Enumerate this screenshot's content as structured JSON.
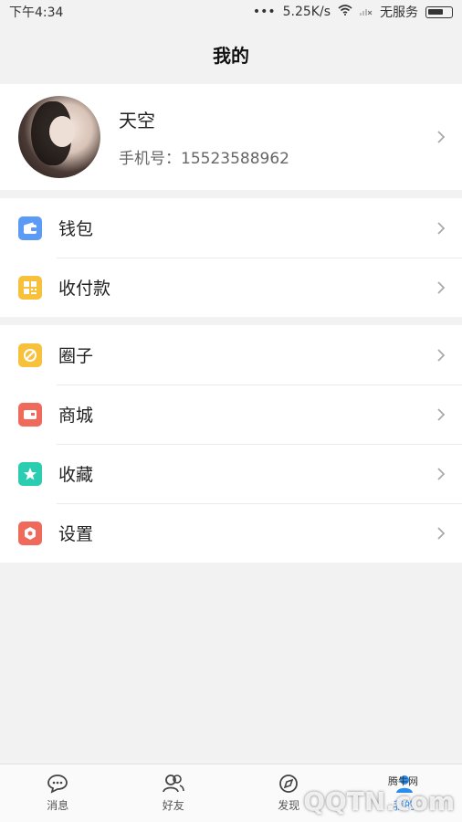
{
  "status_bar": {
    "time": "下午4:34",
    "dots": "•••",
    "speed": "5.25K/s",
    "carrier": "无服务"
  },
  "header": {
    "title": "我的"
  },
  "profile": {
    "name": "天空",
    "phone": "手机号：15523588962"
  },
  "menu_group_1": [
    {
      "label": "钱包",
      "icon": "wallet-icon",
      "color": "#5b9bf5"
    },
    {
      "label": "收付款",
      "icon": "qrcode-icon",
      "color": "#f7c13c"
    }
  ],
  "menu_group_2": [
    {
      "label": "圈子",
      "icon": "circle-icon",
      "color": "#f7c13c"
    },
    {
      "label": "商城",
      "icon": "shop-icon",
      "color": "#ef6a5a"
    },
    {
      "label": "收藏",
      "icon": "star-icon",
      "color": "#2bcdb0"
    },
    {
      "label": "设置",
      "icon": "settings-icon",
      "color": "#ef6a5a"
    }
  ],
  "tabs": [
    {
      "label": "消息",
      "icon": "message-icon"
    },
    {
      "label": "好友",
      "icon": "friends-icon"
    },
    {
      "label": "发现",
      "icon": "discover-icon"
    },
    {
      "label": "我的",
      "icon": "me-icon"
    }
  ],
  "watermark": "QQTN.com",
  "watermark_sub": "腾牛网"
}
